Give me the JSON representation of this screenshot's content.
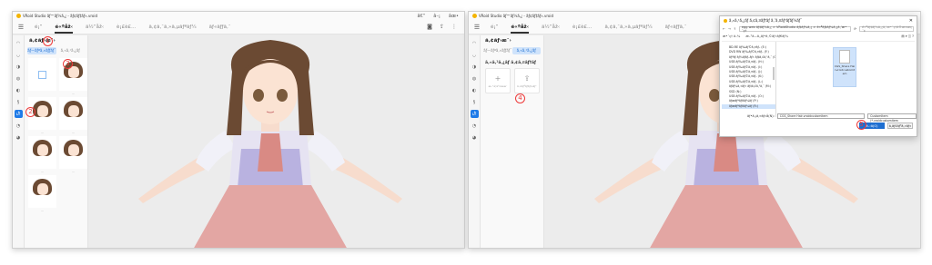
{
  "app": {
    "title": "VRoid Studio ãƒ™ãƒ¼ã‚¿ - ãƒ¢ãƒ‡ãƒ«.vroid",
    "tabs": [
      "é¡”",
      "é«ªåž‹",
      "ä½“åž‹",
      "è¡£è£…",
      "ã‚¢ã‚¯ã‚»ã‚µãƒªãƒ¼",
      "ãƒ«ãƒƒã‚¯"
    ],
    "active_tab": "é«ªåž‹",
    "window_controls": [
      "â€“",
      "â–¡",
      "âœ•"
    ]
  },
  "panel": {
    "title": "ã‚¢ãƒ›æ¯›",
    "segments": [
      "ãƒ—ãƒªã‚»ãƒƒãƒˆ",
      "ã‚«ã‚¹ã‚¿ãƒ "
    ],
    "custom_section": "ã‚«ã‚¹ã‚¿ãƒ ã‚¢ã‚¤ãƒ†ãƒ ",
    "new_item_label": "æ–°è¦ä½œæˆ",
    "import_label": "ã‚¤ãƒ³ãƒãƒ¼ãƒˆ"
  },
  "annotations": [
    "1",
    "2",
    "3",
    "4",
    "5"
  ],
  "dialog": {
    "title": "ã‚«ã‚¹ã‚¿ãƒ ã‚¢ã‚¤ãƒ†ãƒ ã‚’ã‚¤ãƒ³ãƒãƒ¼ãƒˆ",
    "path": "egg web ãƒ‡ãƒ¼ã‚¿ > VRoidStudio ãƒ‡ãƒ¼ã‚¿ > é«ªãƒ‡ãƒ¼ã‚¿ã‚’æ•´ç†",
    "search_placeholder": "é«ªãƒ‡ãƒ¼ã‚¿ã‚’æ•´ç†ã®æ¤œç´¢",
    "toolbar": [
      "æ•´ç† â–¾",
      "æ–°ã—ã„ãƒ•ã‚©ãƒ«ãƒ€ãƒ¼"
    ],
    "tree": [
      "BD-RE ãƒ‰ãƒ©ã‚¤ãƒ– (E:)",
      "DVD RW ãƒ‰ãƒ©ã‚¤ãƒ– (F:)",
      "ãƒªãƒ ãƒ¼ãƒãƒ–ãƒ« ãƒ‡ã‚£ã‚¹ã‚¯ (G:)",
      "USB ãƒ‰ãƒ©ã‚¤ãƒ– (H:)",
      "USB ãƒ‰ãƒ©ã‚¤ãƒ– (I:)",
      "USB ãƒ‰ãƒ©ã‚¤ãƒ– (J:)",
      "USB ãƒ‰ãƒ©ã‚¤ãƒ– (K:)",
      "USB ãƒ‰ãƒ©ã‚¤ãƒ– (L:)",
      "ãƒ­ãƒ¼ã‚«ãƒ« ãƒ‡ã‚£ã‚¹ã‚¯ (M:)",
      "SSD (N:)",
      "USB ãƒ‰ãƒ©ã‚¤ãƒ– (O:)",
      "ãƒœãƒªãƒ¥ãƒ¼ãƒ  (P:)",
      "ãƒœãƒªãƒ¥ãƒ¼ãƒ  (R:)"
    ],
    "tree_selected": "ãƒœãƒªãƒ¥ãƒ¼ãƒ  (R:)",
    "file_name": "CGS_Share Hair.vroidcustomitem",
    "filename_label": "ãƒ•ã‚¡ã‚¤ãƒ«å(N):",
    "filename_value": "CGS_Share Hair.vroidcustomitem",
    "filetype_value": "CustomItem (*.vroidcustomitem",
    "open_label": "é–‹ã(O)",
    "cancel_label": "ã‚­ãƒ£ãƒ³ã‚»ãƒ«"
  }
}
